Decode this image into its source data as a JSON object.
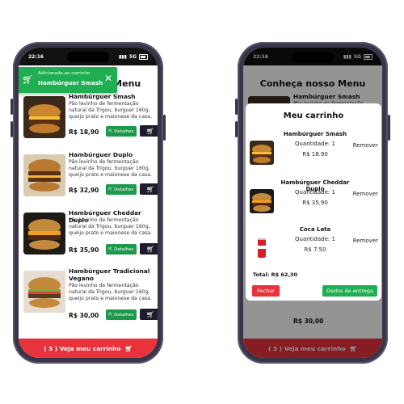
{
  "status": {
    "time": "22:16",
    "network": "5G"
  },
  "menu": {
    "title": "Conheça nosso Menu"
  },
  "toast": {
    "line1": "Adicionado ao carrinho",
    "line2": "Hambúrguer Smash",
    "close_icon": "close-icon",
    "cart_icon": "cart-icon"
  },
  "items": [
    {
      "name": "Hambúrguer Smash",
      "desc": "Pão levinho de fermentação natural da Trigou, burguer 160g, queijo prato e maionese da casa.",
      "price": "R$ 18,90"
    },
    {
      "name": "Hambúrguer Duplo",
      "desc": "Pão levinho de fermentação natural da Trigou, burguer 160g, queijo prato e maionese da casa.",
      "price": "R$ 32,90"
    },
    {
      "name": "Hambúrguer Cheddar Duplo",
      "desc": "Pão levinho de fermentação natural da Trigou, burguer 160g, queijo prato e maionese da casa.",
      "price": "R$ 35,90"
    },
    {
      "name": "Hambúrguer Tradicional Vegano",
      "desc": "Pão levinho de fermentação natural da Trigou, burguer 160g, queijo prato e maionese da casa.",
      "price": "R$ 30,00"
    }
  ],
  "buttons": {
    "details": "Detalhes"
  },
  "bottom_bar": {
    "label": "( 3 ) Veja meu carrinho"
  },
  "cart": {
    "title": "Meu carrinho",
    "items": [
      {
        "name": "Hambúrguer Smash",
        "qty": "Quantidade: 1",
        "price": "R$ 18.90",
        "remove": "Remover"
      },
      {
        "name": "Hambúrguer Cheddar Duplo",
        "qty": "Quantidade: 1",
        "price": "R$ 35.90",
        "remove": "Remover"
      },
      {
        "name": "Coca Lata",
        "qty": "Quantidade: 1",
        "price": "R$ 7.50",
        "remove": "Remover"
      }
    ],
    "total": "Total: R$ 62,30",
    "close": "Fechar",
    "delivery": "Dados de entrega"
  },
  "colors": {
    "green": "#1fae52",
    "red": "#e8323c",
    "dark": "#1c1c2b",
    "frame": "#3a3448"
  }
}
